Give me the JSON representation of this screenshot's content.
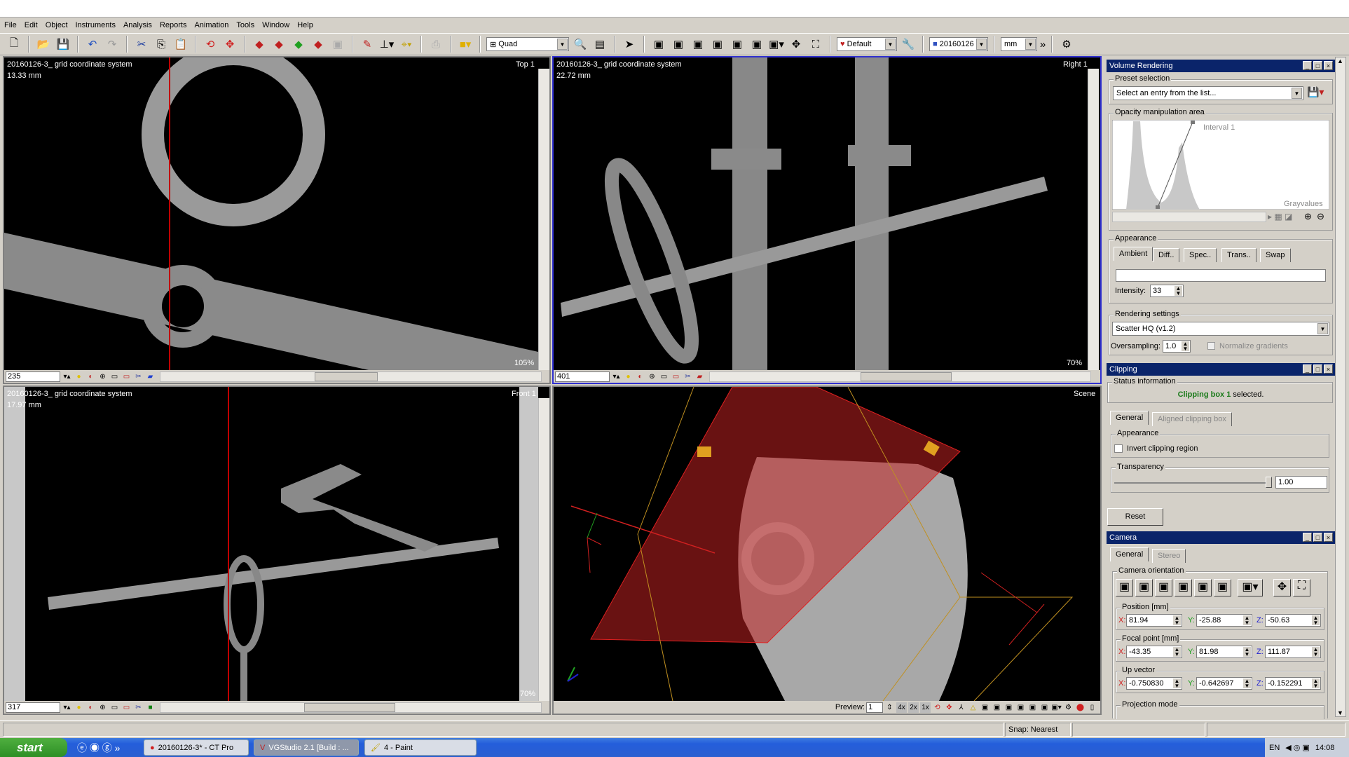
{
  "menu": [
    "File",
    "Edit",
    "Object",
    "Instruments",
    "Analysis",
    "Reports",
    "Animation",
    "Tools",
    "Window",
    "Help"
  ],
  "toolbar": {
    "layout": "Quad",
    "preset": "Default",
    "dataset": "20160126",
    "unit": "mm"
  },
  "viewports": {
    "top": {
      "title": "20160126-3_ grid coordinate system",
      "scale": "13.33 mm",
      "name": "Top 1",
      "slice": "235",
      "zoom": "105%"
    },
    "right": {
      "title": "20160126-3_ grid coordinate system",
      "scale": "22.72 mm",
      "name": "Right 1",
      "slice": "401",
      "zoom": "70%"
    },
    "front": {
      "title": "20160126-3_ grid coordinate system",
      "scale": "17.97 mm",
      "name": "Front 1",
      "slice": "317",
      "zoom": "70%"
    },
    "scene": {
      "name": "Scene",
      "preview_label": "Preview:",
      "preview_value": "1",
      "buttons": [
        "4x",
        "2x",
        "1x"
      ]
    }
  },
  "volume_rendering": {
    "title": "Volume Rendering",
    "preset_group": "Preset selection",
    "preset_placeholder": "Select an entry from the list...",
    "opacity_group": "Opacity manipulation area",
    "interval_label": "Interval 1",
    "axis_label": "Grayvalues",
    "appearance_group": "Appearance",
    "tabs": [
      "Ambient",
      "Diff..",
      "Spec..",
      "Trans..",
      "Swap"
    ],
    "intensity_label": "Intensity:",
    "intensity": "33",
    "rendering_group": "Rendering settings",
    "renderer": "Scatter HQ (v1.2)",
    "oversampling_label": "Oversampling:",
    "oversampling": "1.0",
    "normalize_label": "Normalize gradients"
  },
  "clipping": {
    "title": "Clipping",
    "status_group": "Status information",
    "status_bold": "Clipping box 1",
    "status_rest": " selected.",
    "tabs": [
      "General",
      "Aligned clipping box"
    ],
    "appearance_group": "Appearance",
    "invert_label": "Invert clipping region",
    "transparency_group": "Transparency",
    "transparency": "1.00",
    "reset": "Reset"
  },
  "camera": {
    "title": "Camera",
    "tabs": [
      "General",
      "Stereo"
    ],
    "orientation_group": "Camera orientation",
    "position_group": "Position [mm]",
    "position": {
      "x": "81.94",
      "y": "-25.88",
      "z": "-50.63"
    },
    "focal_group": "Focal point [mm]",
    "focal": {
      "x": "-43.35",
      "y": "81.98",
      "z": "111.87"
    },
    "up_group": "Up vector",
    "up": {
      "x": "-0.750830",
      "y": "-0.642697",
      "z": "-0.152291"
    },
    "axis_labels": {
      "x": "X:",
      "y": "Y:",
      "z": "Z:"
    },
    "projection_group": "Projection mode"
  },
  "statusbar": {
    "snap": "Snap: Nearest"
  },
  "taskbar": {
    "start": "start",
    "tasks": [
      "20160126-3* - CT Pro",
      "VGStudio 2.1  [Build : ...",
      "4 - Paint"
    ],
    "lang": "EN",
    "clock": "14:08"
  },
  "colors": {
    "titlebar": "#0a246a",
    "clip_status": "#1a7a1a",
    "clip_plane": "#c02020",
    "selected_viewport": "#3030d0"
  }
}
